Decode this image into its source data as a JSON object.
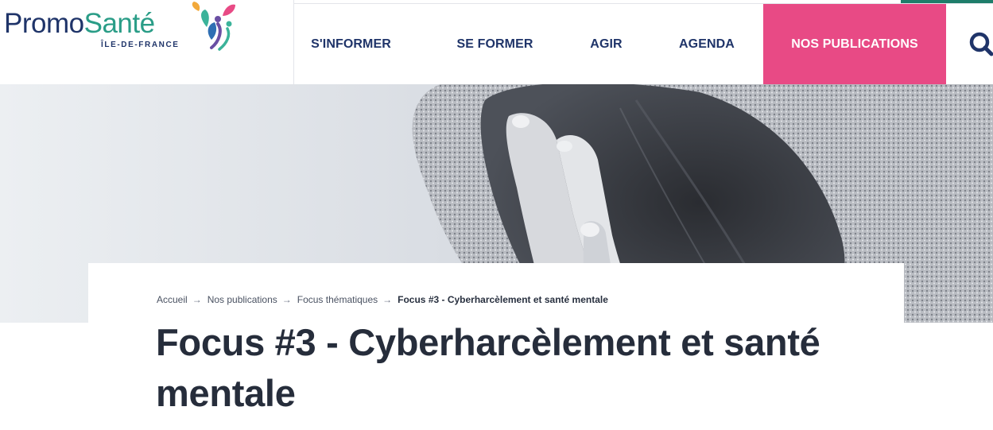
{
  "logo": {
    "part1": "Promo",
    "part2": "Santé",
    "region": "ÎLE-DE-FRANCE",
    "emblem_icon": "people-leaves-emblem-icon"
  },
  "nav": {
    "items": [
      {
        "label": "S'INFORMER"
      },
      {
        "label": "SE FORMER"
      },
      {
        "label": "AGIR"
      },
      {
        "label": "AGENDA"
      },
      {
        "label": "NOS PUBLICATIONS"
      }
    ],
    "search_icon": "search-icon"
  },
  "colors": {
    "navy": "#1f3469",
    "green": "#2a9d87",
    "pink": "#e84a85",
    "title_text": "#262d3b"
  },
  "breadcrumb": {
    "items": [
      "Accueil",
      "Nos publications",
      "Focus thématiques"
    ],
    "separator": "→",
    "current": "Focus #3 - Cyberharcèlement et santé mentale"
  },
  "page": {
    "title": "Focus #3 - Cyberharcèlement et santé mentale"
  },
  "hero": {
    "image": "person-hiding-face-in-hood-photo"
  }
}
